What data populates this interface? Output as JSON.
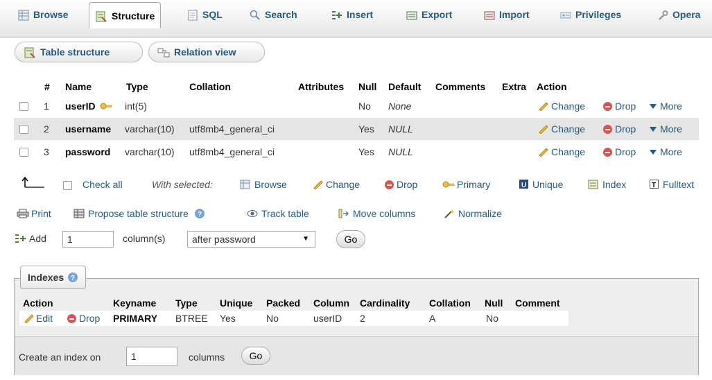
{
  "tabs": [
    {
      "label": "Browse",
      "icon": "table-icon"
    },
    {
      "label": "Structure",
      "icon": "structure-icon",
      "active": true
    },
    {
      "label": "SQL",
      "icon": "sql-icon"
    },
    {
      "label": "Search",
      "icon": "search-icon"
    },
    {
      "label": "Insert",
      "icon": "insert-icon"
    },
    {
      "label": "Export",
      "icon": "export-icon"
    },
    {
      "label": "Import",
      "icon": "import-icon"
    },
    {
      "label": "Privileges",
      "icon": "privileges-icon"
    },
    {
      "label": "Opera",
      "icon": "wrench-icon"
    }
  ],
  "subtabs": {
    "table_structure": "Table structure",
    "relation_view": "Relation view"
  },
  "structure": {
    "headers": {
      "num": "#",
      "name": "Name",
      "type": "Type",
      "collation": "Collation",
      "attributes": "Attributes",
      "null": "Null",
      "default": "Default",
      "comments": "Comments",
      "extra": "Extra",
      "action": "Action"
    },
    "rows": [
      {
        "num": "1",
        "name": "userID",
        "type": "int(5)",
        "collation": "",
        "null": "No",
        "default": "None"
      },
      {
        "num": "2",
        "name": "username",
        "type": "varchar(10)",
        "collation": "utf8mb4_general_ci",
        "null": "Yes",
        "default": "NULL"
      },
      {
        "num": "3",
        "name": "password",
        "type": "varchar(10)",
        "collation": "utf8mb4_general_ci",
        "null": "Yes",
        "default": "NULL"
      }
    ],
    "actions": {
      "change": "Change",
      "drop": "Drop",
      "more": "More"
    }
  },
  "bulk": {
    "check_all": "Check all",
    "with_selected": "With selected:",
    "browse": "Browse",
    "change": "Change",
    "drop": "Drop",
    "primary": "Primary",
    "unique": "Unique",
    "index": "Index",
    "fulltext": "Fulltext"
  },
  "tools": {
    "print": "Print",
    "propose": "Propose table structure",
    "track": "Track table",
    "move": "Move columns",
    "normalize": "Normalize"
  },
  "add": {
    "label": "Add",
    "count": "1",
    "columns_label": "column(s)",
    "position": "after password",
    "go": "Go"
  },
  "indexes": {
    "legend": "Indexes",
    "headers": {
      "action": "Action",
      "keyname": "Keyname",
      "type": "Type",
      "unique": "Unique",
      "packed": "Packed",
      "column": "Column",
      "cardinality": "Cardinality",
      "collation": "Collation",
      "null": "Null",
      "comment": "Comment"
    },
    "row": {
      "edit": "Edit",
      "drop": "Drop",
      "keyname": "PRIMARY",
      "type": "BTREE",
      "unique": "Yes",
      "packed": "No",
      "column": "userID",
      "cardinality": "2",
      "collation": "A",
      "null": "No",
      "comment": ""
    },
    "create_label": "Create an index on",
    "create_count": "1",
    "columns_label": "columns",
    "go": "Go"
  }
}
